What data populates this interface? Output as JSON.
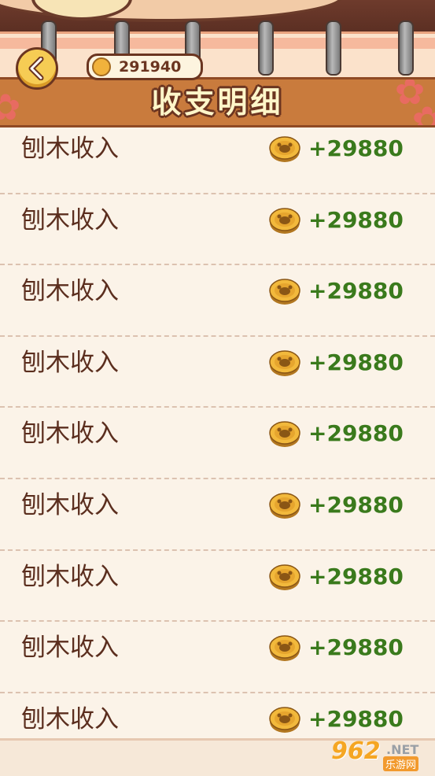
{
  "header": {
    "title": "收支明细",
    "balance": "291940",
    "back_icon": "chevron-left-icon",
    "coin_icon": "coin-icon"
  },
  "records": [
    {
      "label": "刨木收入",
      "amount": "+29880"
    },
    {
      "label": "刨木收入",
      "amount": "+29880"
    },
    {
      "label": "刨木收入",
      "amount": "+29880"
    },
    {
      "label": "刨木收入",
      "amount": "+29880"
    },
    {
      "label": "刨木收入",
      "amount": "+29880"
    },
    {
      "label": "刨木收入",
      "amount": "+29880"
    },
    {
      "label": "刨木收入",
      "amount": "+29880"
    },
    {
      "label": "刨木收入",
      "amount": "+29880"
    },
    {
      "label": "刨木收入",
      "amount": "+29880"
    }
  ],
  "watermark": {
    "number": "962",
    "net": ".NET",
    "cn": "乐游网"
  },
  "colors": {
    "income": "#3a7a1c",
    "text_brown": "#5b2e1e",
    "title_bar": "#c97b3d",
    "background": "#fbf3e8"
  }
}
